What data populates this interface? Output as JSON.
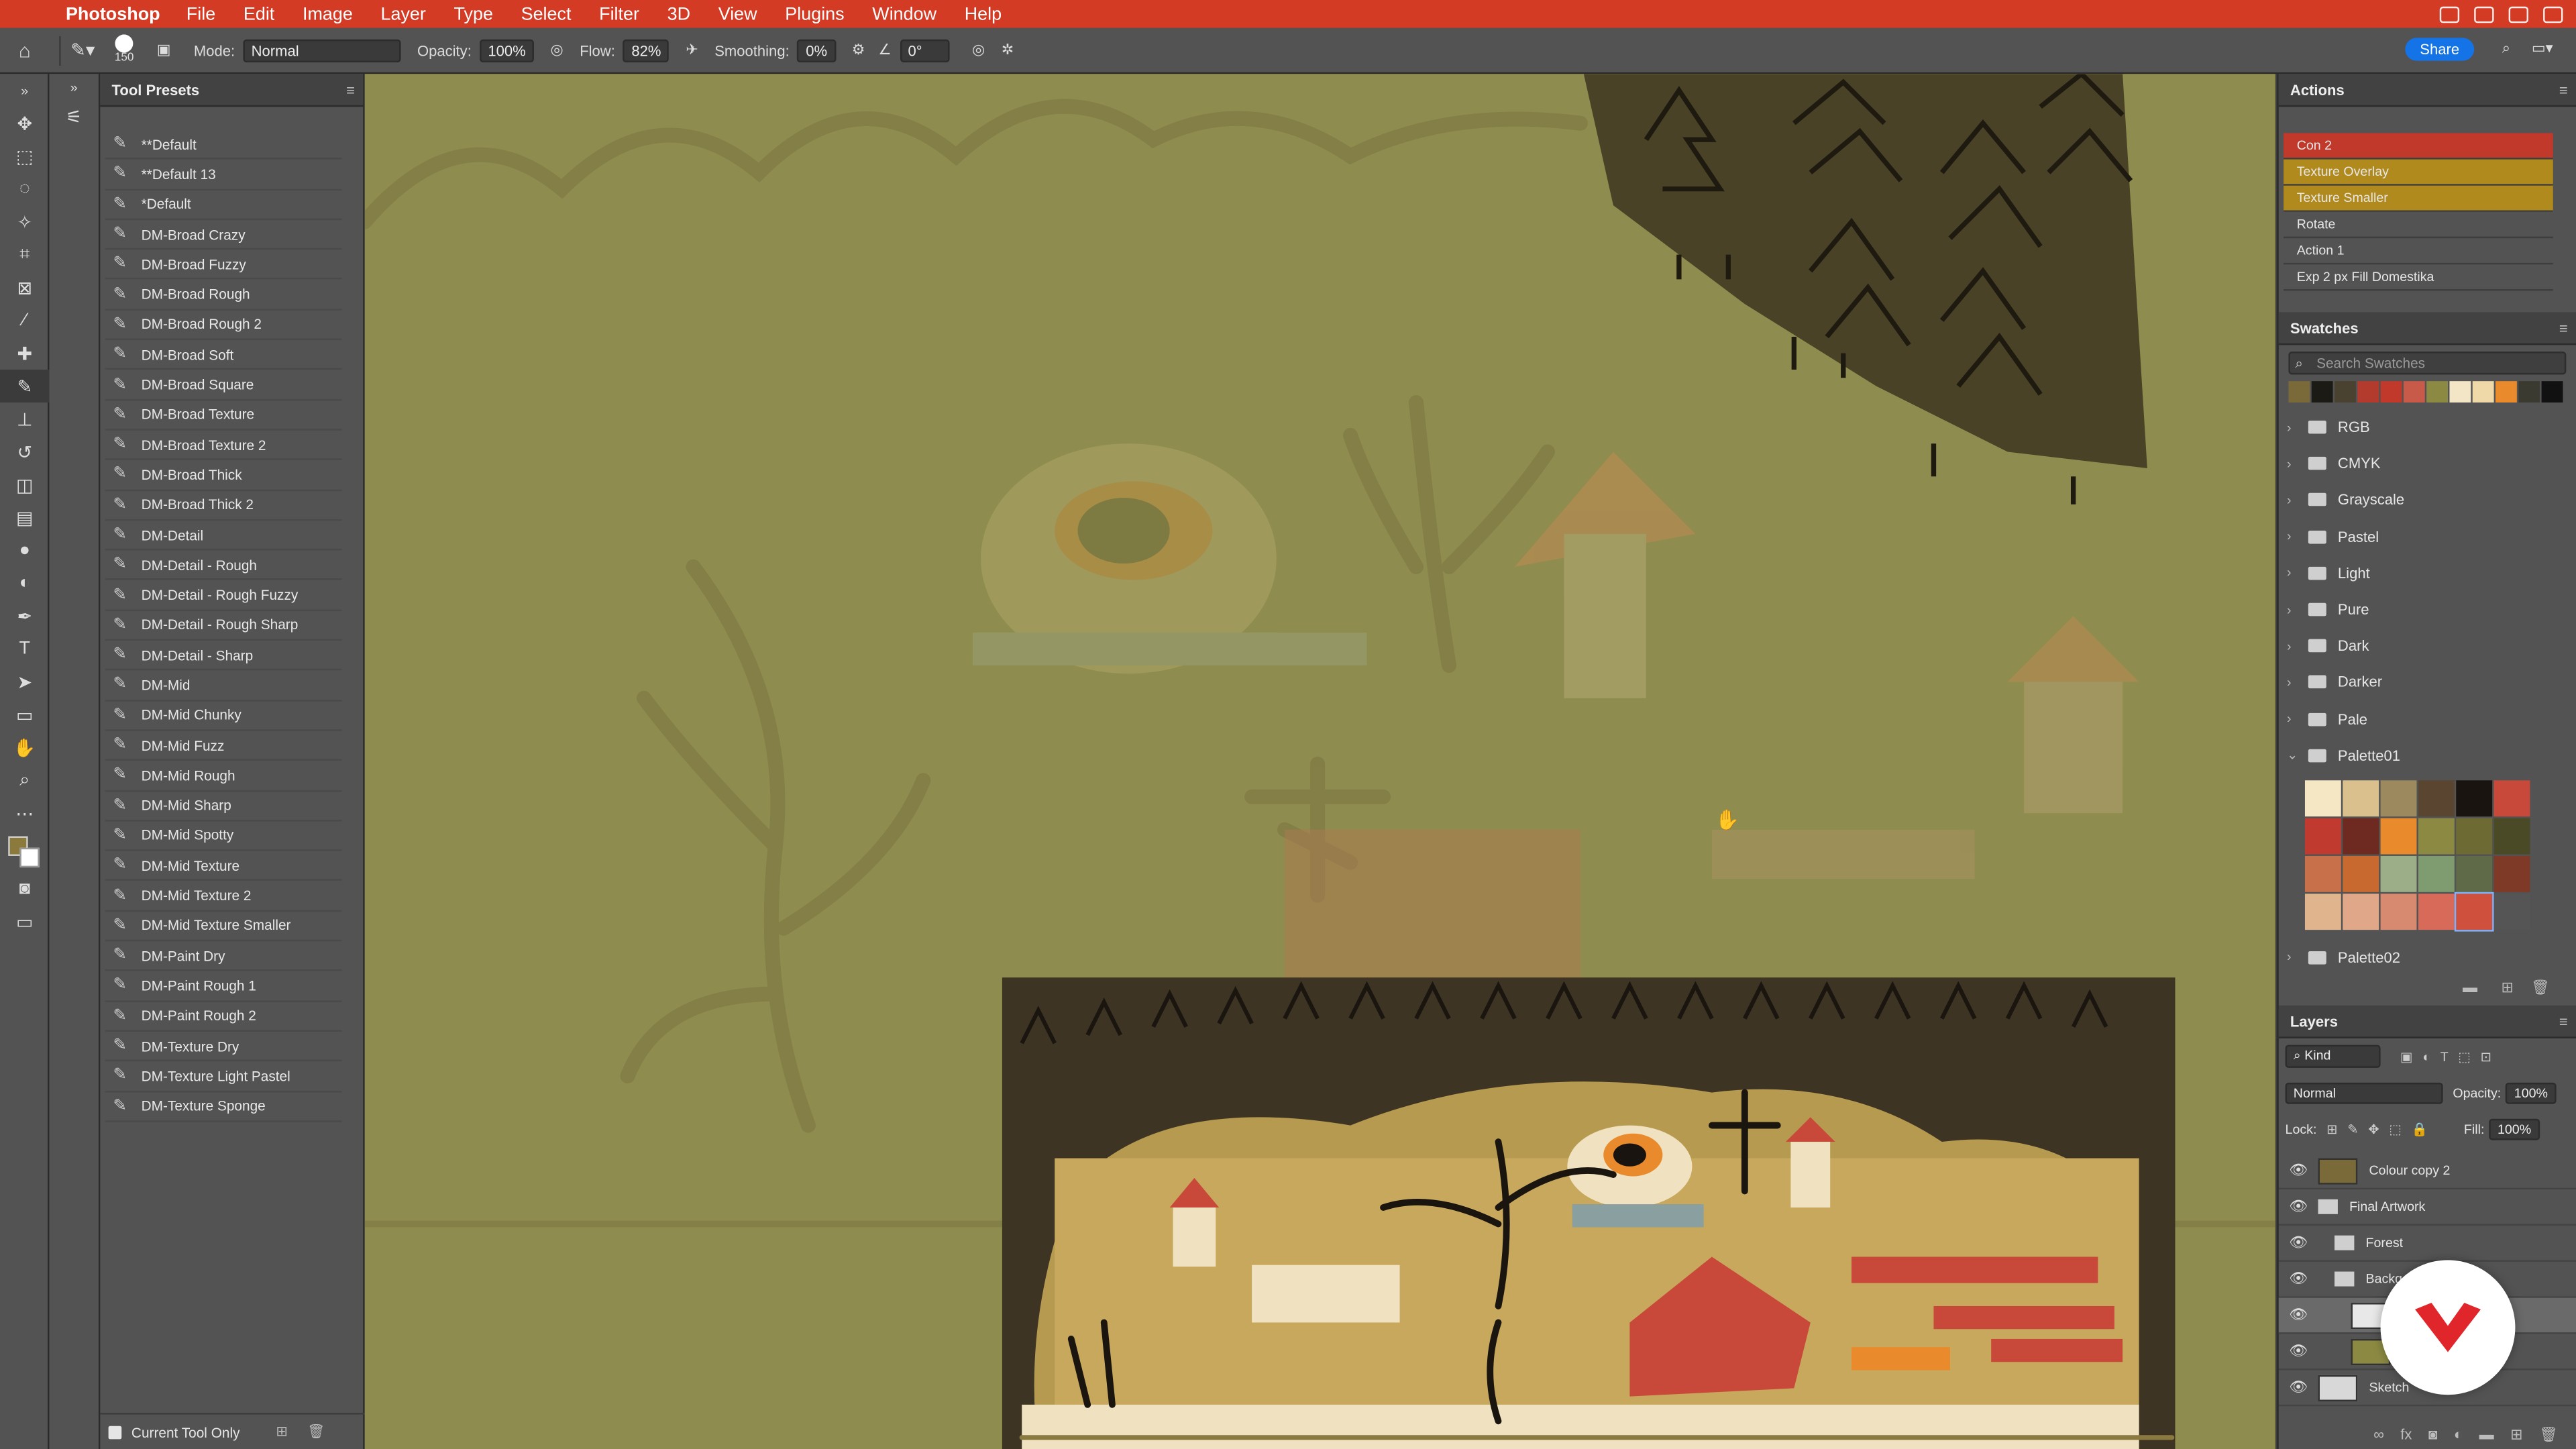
{
  "menubar": {
    "app": "Photoshop",
    "items": [
      "File",
      "Edit",
      "Image",
      "Layer",
      "Type",
      "Select",
      "Filter",
      "3D",
      "View",
      "Plugins",
      "Window",
      "Help"
    ]
  },
  "options": {
    "brush_size": "150",
    "mode_label": "Mode:",
    "mode": "Normal",
    "opacity_label": "Opacity:",
    "opacity": "100%",
    "flow_label": "Flow:",
    "flow": "82%",
    "smoothing_label": "Smoothing:",
    "smoothing": "0%",
    "angle": "0°",
    "share": "Share"
  },
  "presets": {
    "title": "Tool Presets",
    "items": [
      "**Default",
      "**Default 13",
      "*Default",
      "DM-Broad Crazy",
      "DM-Broad Fuzzy",
      "DM-Broad Rough",
      "DM-Broad Rough 2",
      "DM-Broad Soft",
      "DM-Broad Square",
      "DM-Broad Texture",
      "DM-Broad Texture 2",
      "DM-Broad Thick",
      "DM-Broad Thick 2",
      "DM-Detail",
      "DM-Detail - Rough",
      "DM-Detail - Rough Fuzzy",
      "DM-Detail - Rough Sharp",
      "DM-Detail - Sharp",
      "DM-Mid",
      "DM-Mid Chunky",
      "DM-Mid Fuzz",
      "DM-Mid Rough",
      "DM-Mid Sharp",
      "DM-Mid Spotty",
      "DM-Mid Texture",
      "DM-Mid Texture 2",
      "DM-Mid Texture Smaller",
      "DM-Paint Dry",
      "DM-Paint Rough 1",
      "DM-Paint Rough 2",
      "DM-Texture Dry",
      "DM-Texture Light Pastel",
      "DM-Texture Sponge"
    ],
    "footer": "Current Tool Only"
  },
  "actions": {
    "title": "Actions",
    "items": [
      {
        "label": "Con 2",
        "color": "#c0392b"
      },
      {
        "label": "Texture Overlay",
        "color": "#b08a1c"
      },
      {
        "label": "Texture Smaller",
        "color": "#b08a1c"
      },
      {
        "label": "Rotate",
        "color": ""
      },
      {
        "label": "Action 1",
        "color": ""
      },
      {
        "label": "Exp 2 px Fill Domestika",
        "color": ""
      }
    ]
  },
  "swatches": {
    "title": "Swatches",
    "search_placeholder": "Search Swatches",
    "recent": [
      "#7a6a3a",
      "#1c1a14",
      "#4a4230",
      "#b33b2e",
      "#c0392b",
      "#c85a4a",
      "#8c8a42",
      "#f3e6c6",
      "#f0d9a8",
      "#e98a2c",
      "#3a3a30",
      "#111111"
    ],
    "groups": [
      "RGB",
      "CMYK",
      "Grayscale",
      "Pastel",
      "Light",
      "Pure",
      "Dark",
      "Darker",
      "Pale",
      "Palette01",
      "Palette02"
    ],
    "palette01": [
      "#f5e6c4",
      "#d9c08c",
      "#9c8a5e",
      "#5a4630",
      "#1a1410",
      "#c8483a",
      "#c03a30",
      "#6e2a20",
      "#e98a2c",
      "#8c8a42",
      "#6e6a34",
      "#4a4a26",
      "#c8704a",
      "#c86a30",
      "#9cae88",
      "#7e9c70",
      "#5e6a48",
      "#7e3a26",
      "#e0b48c",
      "#e0a888",
      "#d88a70",
      "#d86a5a",
      "#d0503e",
      "#555555"
    ]
  },
  "layers": {
    "title": "Layers",
    "kind": "Kind",
    "blend": "Normal",
    "opacity_label": "Opacity:",
    "opacity": "100%",
    "lock_label": "Lock:",
    "fill_label": "Fill:",
    "fill": "100%",
    "items": [
      {
        "name": "Colour copy 2"
      },
      {
        "name": "Final Artwork"
      },
      {
        "name": "Forest"
      },
      {
        "name": "Backg"
      },
      {
        "name": ""
      },
      {
        "name": ""
      },
      {
        "name": "Sketch"
      }
    ]
  }
}
